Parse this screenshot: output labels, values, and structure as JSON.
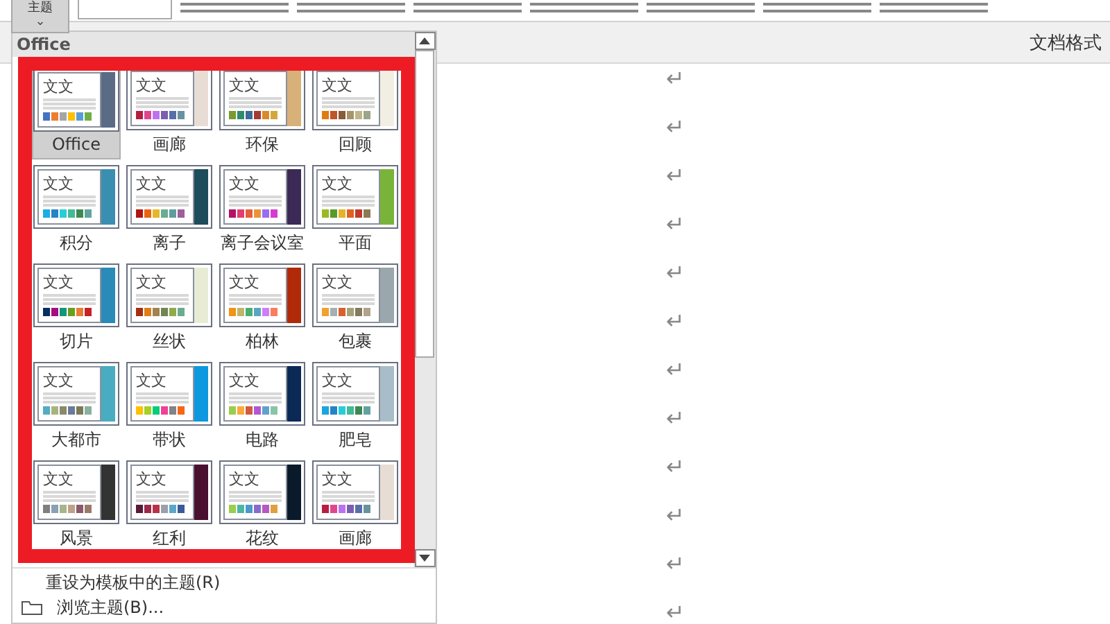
{
  "ribbon": {
    "theme_button": {
      "label": "主题",
      "caret": "⌄"
    }
  },
  "document_bar": {
    "title": "文档格式"
  },
  "theme_menu": {
    "heading": "Office",
    "themes": [
      {
        "name": "Office",
        "sample": "文文",
        "selected": true,
        "color": "#5a6b86",
        "swatches": [
          {
            "color": "#4472c4"
          },
          {
            "color": "#ed7d31"
          },
          {
            "color": "#a5a5a5"
          },
          {
            "color": "#ffc000"
          },
          {
            "color": "#5b9bd5"
          },
          {
            "color": "#70ad47"
          }
        ]
      },
      {
        "name": "画廊",
        "sample": "文文",
        "selected": false,
        "color": "#e8ddd5",
        "swatches": [
          {
            "color": "#b71e42"
          },
          {
            "color": "#de478e"
          },
          {
            "color": "#bc72f0"
          },
          {
            "color": "#795faf"
          },
          {
            "color": "#586ea6"
          },
          {
            "color": "#6892a0"
          }
        ]
      },
      {
        "name": "环保",
        "sample": "文文",
        "selected": false,
        "color": "#d8b07a",
        "swatches": [
          {
            "color": "#7a9a2e"
          },
          {
            "color": "#2e8b6b"
          },
          {
            "color": "#3a6b9a"
          },
          {
            "color": "#a33a33"
          },
          {
            "color": "#d98a2b"
          },
          {
            "color": "#d4a73a"
          }
        ]
      },
      {
        "name": "回顾",
        "sample": "文文",
        "selected": false,
        "color": "#f2eee4",
        "swatches": [
          {
            "color": "#e07b12"
          },
          {
            "color": "#c0542a"
          },
          {
            "color": "#8b5a3a"
          },
          {
            "color": "#a8946a"
          },
          {
            "color": "#c0b586"
          },
          {
            "color": "#9aa58a"
          }
        ]
      },
      {
        "name": "积分",
        "sample": "文文",
        "selected": false,
        "color": "#3a8fb0",
        "swatches": [
          {
            "color": "#1cade4"
          },
          {
            "color": "#2683c6"
          },
          {
            "color": "#27ced7"
          },
          {
            "color": "#42ba97"
          },
          {
            "color": "#3e8853"
          },
          {
            "color": "#62a39f"
          }
        ]
      },
      {
        "name": "离子",
        "sample": "文文",
        "selected": false,
        "color": "#1d4c5a",
        "swatches": [
          {
            "color": "#b01513"
          },
          {
            "color": "#ea6312"
          },
          {
            "color": "#e6b729"
          },
          {
            "color": "#6aac90"
          },
          {
            "color": "#5f9c9d"
          },
          {
            "color": "#9e5e9b"
          }
        ]
      },
      {
        "name": "离子会议室",
        "sample": "文文",
        "selected": false,
        "color": "#3a2a55",
        "swatches": [
          {
            "color": "#b31166"
          },
          {
            "color": "#e33d6f"
          },
          {
            "color": "#e45f3c"
          },
          {
            "color": "#e9943a"
          },
          {
            "color": "#9b6bf2"
          },
          {
            "color": "#d53dd0"
          }
        ]
      },
      {
        "name": "平面",
        "sample": "文文",
        "selected": false,
        "color": "#7ab33a",
        "swatches": [
          {
            "color": "#9aba24"
          },
          {
            "color": "#5a9a2a"
          },
          {
            "color": "#e6b22a"
          },
          {
            "color": "#e06020"
          },
          {
            "color": "#c0392b"
          },
          {
            "color": "#8c7a55"
          }
        ]
      },
      {
        "name": "切片",
        "sample": "文文",
        "selected": false,
        "color": "#2a8ab8",
        "swatches": [
          {
            "color": "#052f61"
          },
          {
            "color": "#a50e82"
          },
          {
            "color": "#14967c"
          },
          {
            "color": "#6a9e1f"
          },
          {
            "color": "#e87d37"
          },
          {
            "color": "#c62324"
          }
        ]
      },
      {
        "name": "丝状",
        "sample": "文文",
        "selected": false,
        "color": "#e8ecd5",
        "swatches": [
          {
            "color": "#a53010"
          },
          {
            "color": "#de7e18"
          },
          {
            "color": "#9f8351"
          },
          {
            "color": "#728653"
          },
          {
            "color": "#92aa4c"
          },
          {
            "color": "#6aac91"
          }
        ]
      },
      {
        "name": "柏林",
        "sample": "文文",
        "selected": false,
        "color": "#b02a0a",
        "swatches": [
          {
            "color": "#f09415"
          },
          {
            "color": "#c1b56b"
          },
          {
            "color": "#4baf73"
          },
          {
            "color": "#5aa6c0"
          },
          {
            "color": "#d17df9"
          },
          {
            "color": "#fa7e5c"
          }
        ]
      },
      {
        "name": "包裹",
        "sample": "文文",
        "selected": false,
        "color": "#9aa7ad",
        "swatches": [
          {
            "color": "#f0a22e"
          },
          {
            "color": "#a5b0b4"
          },
          {
            "color": "#d8602e"
          },
          {
            "color": "#a5a27a"
          },
          {
            "color": "#847a5e"
          },
          {
            "color": "#b0a38a"
          }
        ]
      },
      {
        "name": "大都市",
        "sample": "文文",
        "selected": false,
        "color": "#4aacc0",
        "swatches": [
          {
            "color": "#52aec0"
          },
          {
            "color": "#a8b47e"
          },
          {
            "color": "#8a8a6a"
          },
          {
            "color": "#6a7a9a"
          },
          {
            "color": "#7a7a5a"
          },
          {
            "color": "#8ab0a0"
          }
        ]
      },
      {
        "name": "带状",
        "sample": "文文",
        "selected": false,
        "color": "#0e98e0",
        "swatches": [
          {
            "color": "#ffc000"
          },
          {
            "color": "#a5d028"
          },
          {
            "color": "#08cc78"
          },
          {
            "color": "#f24099"
          },
          {
            "color": "#828288"
          },
          {
            "color": "#f56617"
          }
        ]
      },
      {
        "name": "电路",
        "sample": "文文",
        "selected": false,
        "color": "#0a2a55",
        "swatches": [
          {
            "color": "#9acd4c"
          },
          {
            "color": "#faa93a"
          },
          {
            "color": "#d35940"
          },
          {
            "color": "#b258d3"
          },
          {
            "color": "#63a0cc"
          },
          {
            "color": "#8ac4a7"
          }
        ]
      },
      {
        "name": "肥皂",
        "sample": "文文",
        "selected": false,
        "color": "#a9bdc9",
        "swatches": [
          {
            "color": "#1ca4e0"
          },
          {
            "color": "#2683c6"
          },
          {
            "color": "#27ced7"
          },
          {
            "color": "#42ba97"
          },
          {
            "color": "#3e8853"
          },
          {
            "color": "#62a39f"
          }
        ]
      },
      {
        "name": "风景",
        "sample": "文文",
        "selected": false,
        "color": "#333333",
        "swatches": [
          {
            "color": "#7f7f7f"
          },
          {
            "color": "#8aa0b4"
          },
          {
            "color": "#a8b48a"
          },
          {
            "color": "#c0a08a"
          },
          {
            "color": "#8a5a6a"
          },
          {
            "color": "#9a7a6a"
          }
        ]
      },
      {
        "name": "红利",
        "sample": "文文",
        "selected": false,
        "color": "#4a1030",
        "swatches": [
          {
            "color": "#5a1a3a"
          },
          {
            "color": "#9a2a4a"
          },
          {
            "color": "#b8334a"
          },
          {
            "color": "#9aa0a8"
          },
          {
            "color": "#5aa8c8"
          },
          {
            "color": "#3a5a9a"
          }
        ]
      },
      {
        "name": "花纹",
        "sample": "文文",
        "selected": false,
        "color": "#0a1a2a",
        "swatches": [
          {
            "color": "#9acd4c"
          },
          {
            "color": "#4ab8a0"
          },
          {
            "color": "#4a9acd"
          },
          {
            "color": "#8a6acd"
          },
          {
            "color": "#b45ac0"
          },
          {
            "color": "#e0a040"
          }
        ]
      },
      {
        "name": "画廊",
        "sample": "文文",
        "selected": false,
        "color": "#e8ddd5",
        "swatches": [
          {
            "color": "#b71e42"
          },
          {
            "color": "#de478e"
          },
          {
            "color": "#bc72f0"
          },
          {
            "color": "#795faf"
          },
          {
            "color": "#586ea6"
          },
          {
            "color": "#6892a0"
          }
        ]
      }
    ],
    "actions": [
      {
        "kind": "plain",
        "label": "重设为模板中的主题(R)"
      },
      {
        "kind": "folder",
        "label": "浏览主题(B)..."
      }
    ]
  },
  "paragraph_marks": [
    "↵",
    "↵",
    "↵",
    "↵",
    "↵",
    "↵",
    "↵",
    "↵",
    "↵",
    "↵",
    "↵",
    "↵"
  ]
}
